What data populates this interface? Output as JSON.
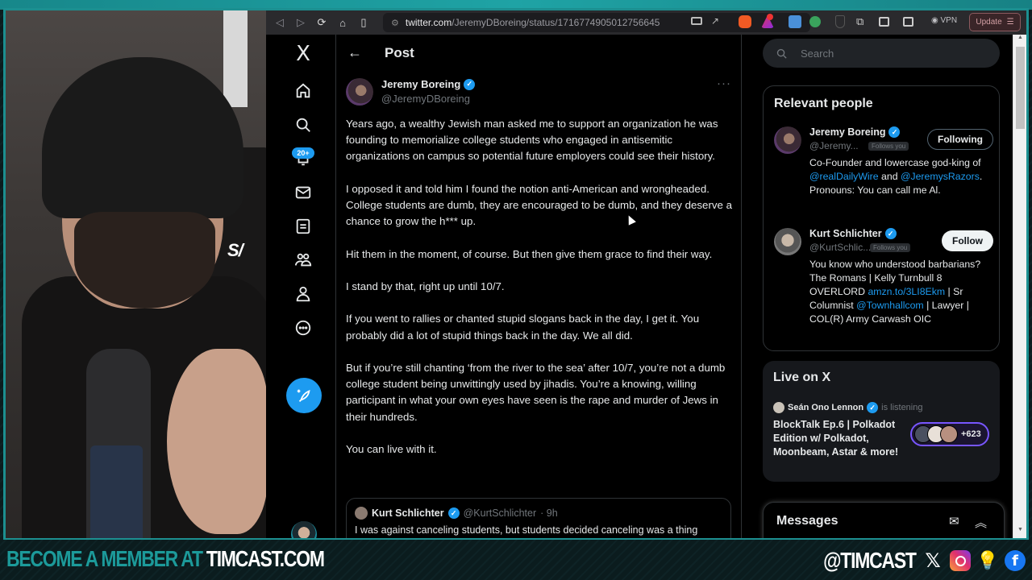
{
  "browser": {
    "url_host": "twitter.com",
    "url_path": "/JeremyDBoreing/status/1716774905012756645",
    "vpn_label": "VPN",
    "update_label": "Update"
  },
  "nav": {
    "logo": "X",
    "items": [
      {
        "name": "home-icon",
        "label": "Home"
      },
      {
        "name": "search-icon",
        "label": "Explore"
      },
      {
        "name": "bell-icon",
        "label": "Notifications"
      },
      {
        "name": "mail-icon",
        "label": "Messages"
      },
      {
        "name": "list-icon",
        "label": "Lists"
      },
      {
        "name": "communities-icon",
        "label": "Communities"
      },
      {
        "name": "profile-icon",
        "label": "Profile"
      },
      {
        "name": "more-icon",
        "label": "More"
      }
    ],
    "notifications_badge": "20+",
    "compose_label": "Post"
  },
  "post": {
    "header_title": "Post",
    "author_name": "Jeremy Boreing",
    "author_handle": "@JeremyDBoreing",
    "verified": true,
    "paragraphs": [
      "Years ago, a wealthy Jewish man asked me to support an organization he was founding to memorialize college students who engaged in antisemitic organizations on campus so potential future employers could see their history.",
      "I opposed it and told him I found the notion anti-American and wrongheaded. College students are dumb, they are encouraged to be dumb, and they deserve a chance to grow the h*** up.",
      "Hit them in the moment, of course. But then give them grace to find their way.",
      "I stand by that, right up until 10/7.",
      "If you went to rallies or chanted stupid slogans back in the day, I get it. You probably did a lot of stupid things back in the day. We all did.",
      "But if you’re still chanting ‘from the river to the sea’ after 10/7, you’re not a dumb college student being unwittingly used by jihadis. You’re a knowing, willing participant in what your own eyes have seen is the rape and murder of Jews in their hundreds.",
      "You can live with it."
    ],
    "quote": {
      "name": "Kurt Schlichter",
      "handle": "@KurtSchlichter",
      "time": "· 9h",
      "text": "I was against canceling students, but students decided canceling was a thing"
    }
  },
  "sidebar": {
    "search_placeholder": "Search",
    "relevant_title": "Relevant people",
    "people": [
      {
        "name": "Jeremy Boreing",
        "handle": "@Jeremy...",
        "follows_you": "Follows you",
        "button": "Following",
        "bio_parts": [
          {
            "text": "Co-Founder and lowercase god-king of ",
            "link": false
          },
          {
            "text": "@realDailyWire",
            "link": true
          },
          {
            "text": " and ",
            "link": false
          },
          {
            "text": "@JeremysRazors",
            "link": true
          },
          {
            "text": ". Pronouns: You can call me Al.",
            "link": false
          }
        ]
      },
      {
        "name": "Kurt Schlichter",
        "handle": "@KurtSchlic...",
        "follows_you": "Follows you",
        "button": "Follow",
        "bio_parts": [
          {
            "text": "You know who understood barbarians? The Romans | Kelly Turnbull 8 OVERLORD ",
            "link": false
          },
          {
            "text": "amzn.to/3LI8Ekm",
            "link": true
          },
          {
            "text": " | Sr Columnist ",
            "link": false
          },
          {
            "text": "@Townhallcom",
            "link": true
          },
          {
            "text": " | Lawyer | COL(R) Army Carwash OIC",
            "link": false
          }
        ]
      }
    ],
    "live": {
      "title": "Live on X",
      "host_name": "Seán Ono Lennon",
      "host_status": "is listening",
      "space_title": "BlockTalk Ep.6 | Polkadot Edition w/ Polkadot, Moonbeam, Astar & more!",
      "listener_count": "+623"
    },
    "messages_title": "Messages"
  },
  "overlay": {
    "cta_prefix": "BECOME A MEMBER AT ",
    "cta_site": "TIMCAST.COM",
    "social_handle": "@TIMCAST",
    "social_icons": [
      "x-icon",
      "instagram-icon",
      "lightbulb-icon",
      "facebook-icon"
    ]
  },
  "colors": {
    "accent_blue": "#1d9bf0",
    "brand_teal": "#1c9a9a",
    "live_purple": "#7856ff"
  }
}
